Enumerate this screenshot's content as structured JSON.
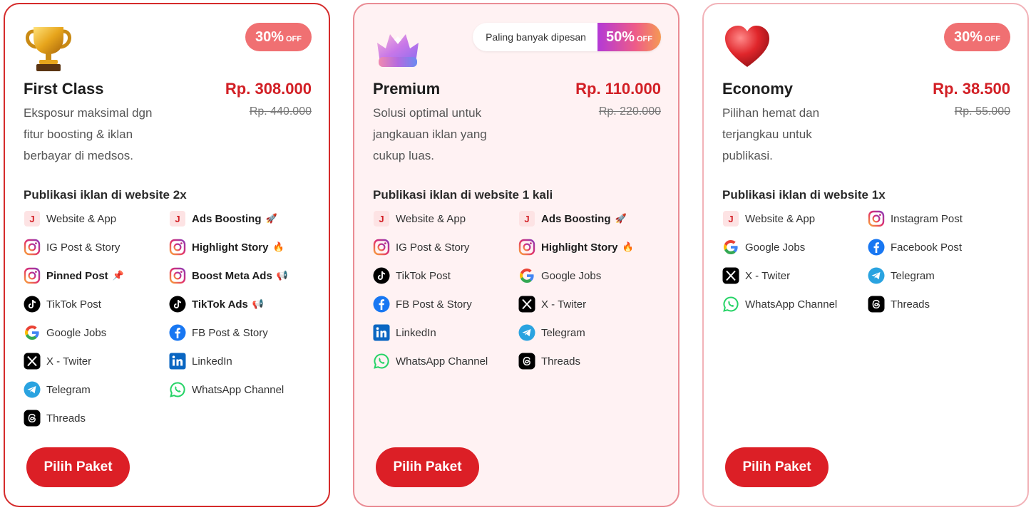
{
  "colors": {
    "accent": "#dc1f26",
    "price": "#d21f25",
    "discount_badge": "#f07072"
  },
  "cards": [
    {
      "icon": "trophy-icon",
      "discount": "30%",
      "discount_suffix": "OFF",
      "name": "First Class",
      "price": "Rp. 308.000",
      "old_price": "Rp. 440.000",
      "description": "Eksposur maksimal dgn fitur boosting & iklan berbayar di medsos.",
      "publication": "Publikasi iklan di website 2x",
      "features": [
        {
          "label": "Website & App",
          "icon": "jobs-app-icon",
          "bold": false
        },
        {
          "label": "Ads Boosting",
          "icon": "jobs-app-icon",
          "bold": true,
          "suffix": "🚀"
        },
        {
          "label": "IG Post & Story",
          "icon": "instagram-icon",
          "bold": false
        },
        {
          "label": "Highlight Story",
          "icon": "instagram-icon",
          "bold": true,
          "suffix": "🔥"
        },
        {
          "label": "Pinned Post",
          "icon": "instagram-icon",
          "bold": true,
          "suffix": "📌"
        },
        {
          "label": "Boost Meta Ads",
          "icon": "instagram-icon",
          "bold": true,
          "suffix": "📢"
        },
        {
          "label": "TikTok Post",
          "icon": "tiktok-icon",
          "bold": false
        },
        {
          "label": "TikTok Ads",
          "icon": "tiktok-icon",
          "bold": true,
          "suffix": "📢"
        },
        {
          "label": "Google Jobs",
          "icon": "google-icon",
          "bold": false
        },
        {
          "label": "FB Post & Story",
          "icon": "facebook-icon",
          "bold": false
        },
        {
          "label": "X - Twiter",
          "icon": "x-icon",
          "bold": false
        },
        {
          "label": "LinkedIn",
          "icon": "linkedin-icon",
          "bold": false
        },
        {
          "label": "Telegram",
          "icon": "telegram-icon",
          "bold": false
        },
        {
          "label": "WhatsApp Channel",
          "icon": "whatsapp-icon",
          "bold": false
        },
        {
          "label": "Threads",
          "icon": "threads-icon",
          "bold": false
        }
      ],
      "button": "Pilih Paket"
    },
    {
      "icon": "crown-icon",
      "popular_label": "Paling banyak dipesan",
      "discount": "50%",
      "discount_suffix": "OFF",
      "name": "Premium",
      "price": "Rp. 110.000",
      "old_price": "Rp. 220.000",
      "description": "Solusi optimal untuk jangkauan iklan yang cukup luas.",
      "publication": "Publikasi iklan di website 1 kali",
      "features": [
        {
          "label": "Website & App",
          "icon": "jobs-app-icon",
          "bold": false
        },
        {
          "label": "Ads Boosting",
          "icon": "jobs-app-icon",
          "bold": true,
          "suffix": "🚀"
        },
        {
          "label": "IG Post & Story",
          "icon": "instagram-icon",
          "bold": false
        },
        {
          "label": "Highlight Story",
          "icon": "instagram-icon",
          "bold": true,
          "suffix": "🔥"
        },
        {
          "label": "TikTok Post",
          "icon": "tiktok-icon",
          "bold": false
        },
        {
          "label": "Google Jobs",
          "icon": "google-icon",
          "bold": false
        },
        {
          "label": "FB Post & Story",
          "icon": "facebook-icon",
          "bold": false
        },
        {
          "label": "X - Twiter",
          "icon": "x-icon",
          "bold": false
        },
        {
          "label": "LinkedIn",
          "icon": "linkedin-icon",
          "bold": false
        },
        {
          "label": "Telegram",
          "icon": "telegram-icon",
          "bold": false
        },
        {
          "label": "WhatsApp Channel",
          "icon": "whatsapp-icon",
          "bold": false
        },
        {
          "label": "Threads",
          "icon": "threads-icon",
          "bold": false
        }
      ],
      "button": "Pilih Paket"
    },
    {
      "icon": "heart-icon",
      "discount": "30%",
      "discount_suffix": "OFF",
      "name": "Economy",
      "price": "Rp. 38.500",
      "old_price": "Rp. 55.000",
      "description": "Pilihan hemat dan terjangkau untuk publikasi.",
      "publication": "Publikasi iklan di website 1x",
      "features": [
        {
          "label": "Website & App",
          "icon": "jobs-app-icon",
          "bold": false
        },
        {
          "label": "Instagram Post",
          "icon": "instagram-icon",
          "bold": false
        },
        {
          "label": "Google Jobs",
          "icon": "google-icon",
          "bold": false
        },
        {
          "label": "Facebook Post",
          "icon": "facebook-icon",
          "bold": false
        },
        {
          "label": "X - Twiter",
          "icon": "x-icon",
          "bold": false
        },
        {
          "label": "Telegram",
          "icon": "telegram-icon",
          "bold": false
        },
        {
          "label": "WhatsApp Channel",
          "icon": "whatsapp-icon",
          "bold": false
        },
        {
          "label": "Threads",
          "icon": "threads-icon",
          "bold": false
        }
      ],
      "button": "Pilih Paket"
    }
  ]
}
